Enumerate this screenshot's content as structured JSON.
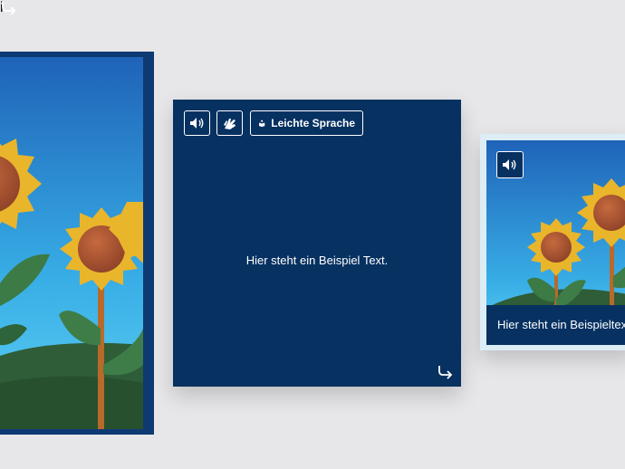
{
  "left_card": {
    "info_icon": "info-icon",
    "flip_icon": "flip-arrow-icon"
  },
  "middle_card": {
    "audio_icon": "speaker-icon",
    "sign_language_icon": "sign-language-hands-icon",
    "easy_language_icon": "easy-language-book-icon",
    "easy_language_label": "Leichte Sprache",
    "body_text": "Hier steht ein Beispiel Text.",
    "flip_icon": "flip-arrow-icon"
  },
  "right_card": {
    "audio_icon": "speaker-icon",
    "caption": "Hier steht ein Beispieltext."
  },
  "colors": {
    "background": "#e7e7e9",
    "navy": "#063161",
    "sky_top": "#1f6fc4",
    "sky_bottom": "#3fb8ea",
    "hill": "#2f5f3a",
    "petal": "#f0c030",
    "center": "#b05a36"
  }
}
